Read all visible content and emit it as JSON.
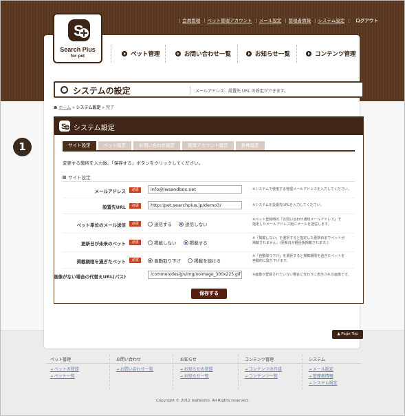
{
  "colors": {
    "brand_dark": "#3b2414",
    "header_bg": "#5a3820",
    "required": "#c8421e",
    "save": "#5a1e10"
  },
  "topnav": {
    "items": [
      "会員管理",
      "ペット管理アカウント",
      "メール設定",
      "管理者情報",
      "システム設定"
    ],
    "logout": "ログアウト"
  },
  "logo": {
    "line1": "Search Plus",
    "line2": "for pet"
  },
  "globalnav": [
    "ペット管理",
    "お問い合わせ一覧",
    "お知らせ一覧",
    "コンテンツ管理"
  ],
  "page": {
    "title": "システムの設定",
    "description": "メールアドレス、設置先 URL の設定ができます。"
  },
  "breadcrumb": {
    "home": "ホーム",
    "sep1": "»",
    "current": "システム設定",
    "sep2": "»",
    "status": "完了"
  },
  "step_badge": "1",
  "panel": {
    "title": "システム設定",
    "tabs": [
      "サイト設定",
      "ペット設定",
      "お問い合わせ設定",
      "管理アカウント設定",
      "会員設定"
    ],
    "intro": "変更する箇所を入力後、「保存する」ボタンをクリックしてください。",
    "section": "サイト設定",
    "required_label": "必須",
    "rows": [
      {
        "label": "メールアドレス",
        "value": "info@lwsandbox.net",
        "note": "※システムで使用する管理メールアドレスを入力してください。"
      },
      {
        "label": "設置先URL",
        "value": "http://pet.searchplus.jp/demo3/",
        "note": "※システムを設置先URLを入力してください。"
      },
      {
        "label": "ペット単位のメール送信",
        "options": [
          "送信する",
          "送信しない"
        ],
        "selected": 1,
        "note": "※ペット登録時の「お問い合わせ通知メールアドレス」で\n指定したメールアドレス宛にメールを送信します。"
      },
      {
        "label": "更新日が未来のペット",
        "options": [
          "掲載しない",
          "掲載する"
        ],
        "selected": 1,
        "note": "※「掲載しない」を選択すると指定した更新日までペットが\n掲載されません。(更新日が経過後掲載されます。)"
      },
      {
        "label": "掲載期限を過ぎたペット",
        "options": [
          "自動取り下げ",
          "掲載を続ける"
        ],
        "selected": 0,
        "note": "※「自動取り下げ」を選択すると掲載期限を過ぎたペットを\n自動的に取り下げます。"
      },
      {
        "label": "画像がない場合の代替えURL(パス)",
        "value": "/common/design/img/noimage_300x225.gif",
        "note": "※画像が登録されていない場合に代わりに表示される画像です。"
      }
    ],
    "save": "保存する"
  },
  "pagetop": "▲  Page Top",
  "footer": {
    "columns": [
      {
        "title": "ペット管理",
        "links": [
          "ペットの登録",
          "ペット一覧"
        ]
      },
      {
        "title": "お問い合わせ",
        "links": [
          "お問い合わせ一覧"
        ]
      },
      {
        "title": "お知らせ",
        "links": [
          "お知らせの登録",
          "お知らせ一覧"
        ]
      },
      {
        "title": "コンテンツ管理",
        "links": [
          "コンテンツの作成",
          "コンテンツ一覧"
        ]
      },
      {
        "title": "システム",
        "links": [
          "メール設定",
          "管理者情報",
          "システム設定"
        ]
      }
    ],
    "copyright": "Copyright © 2012 leafworks. All Rights reserved."
  }
}
